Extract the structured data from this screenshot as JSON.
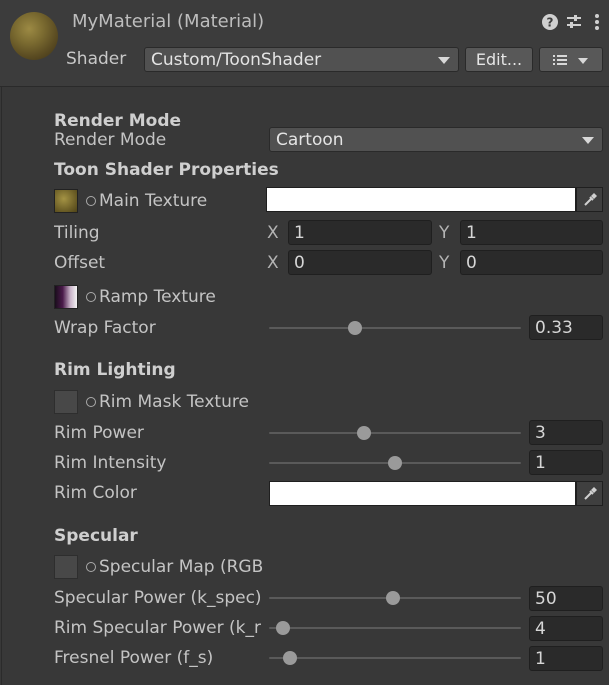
{
  "header": {
    "material_title": "MyMaterial (Material)",
    "shader_label": "Shader",
    "shader_value": "Custom/ToonShader",
    "edit_button": "Edit...",
    "help_icon": "help-icon",
    "settings_icon": "settings-icon",
    "menu_icon": "kebab-menu-icon"
  },
  "render_mode": {
    "heading": "Render Mode",
    "label": "Render Mode",
    "value": "Cartoon"
  },
  "toon": {
    "heading": "Toon Shader Properties",
    "main_texture_label": "Main Texture",
    "tiling_label": "Tiling",
    "tiling_x_axis": "X",
    "tiling_x": "1",
    "tiling_y_axis": "Y",
    "tiling_y": "1",
    "offset_label": "Offset",
    "offset_x_axis": "X",
    "offset_x": "0",
    "offset_y_axis": "Y",
    "offset_y": "0",
    "ramp_texture_label": "Ramp Texture",
    "wrap_factor_label": "Wrap Factor",
    "wrap_factor_value": "0.33",
    "wrap_factor_fraction": 0.33
  },
  "rim": {
    "heading": "Rim Lighting",
    "mask_label": "Rim Mask Texture",
    "power_label": "Rim Power",
    "power_value": "3",
    "power_fraction": 0.37,
    "intensity_label": "Rim Intensity",
    "intensity_value": "1",
    "intensity_fraction": 0.5,
    "color_label": "Rim Color"
  },
  "specular": {
    "heading": "Specular",
    "map_label": "Specular Map (RGB",
    "power_label": "Specular Power (k_spec)",
    "power_value": "50",
    "power_fraction": 0.49,
    "rim_power_label": "Rim Specular Power (k_r",
    "rim_power_value": "4",
    "rim_power_fraction": 0.03,
    "fresnel_label": "Fresnel Power (f_s)",
    "fresnel_value": "1",
    "fresnel_fraction": 0.06
  },
  "colors": {
    "background": "#383838",
    "field": "#2a2a2a",
    "text": "#c4c4c4",
    "main_color": "#ffffff",
    "rim_color": "#ffffff"
  }
}
